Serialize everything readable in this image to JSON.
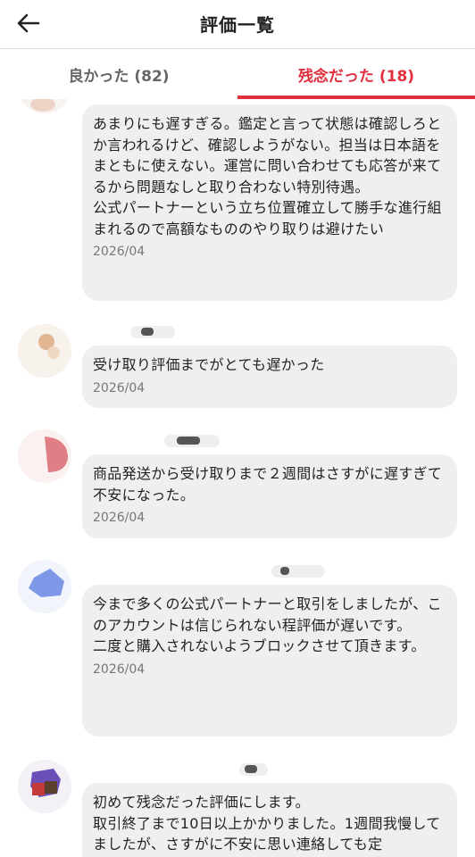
{
  "header": {
    "title": "評価一覧",
    "back_icon": "arrow-left-icon"
  },
  "tabs": [
    {
      "label": "良かった (82)",
      "active": false
    },
    {
      "label": "残念だった (18)",
      "active": true
    }
  ],
  "colors": {
    "accent": "#e0303d",
    "bubble": "#efefef",
    "text": "#222222",
    "muted": "#777777"
  },
  "reviews": [
    {
      "text": "あまりにも遅すぎる。鑑定と言って状態は確認しろとか言われるけど、確認しようがない。担当は日本語をまともに使えない。運営に問い合わせても応答が来てるから問題なしと取り合わない特別待遇。\n公式パートナーという立ち位置確立して勝手な進行組まれるので高額なもののやり取りは避けたい",
      "date": "2026/04"
    },
    {
      "text": "受け取り評価までがとても遅かった",
      "date": "2026/04"
    },
    {
      "text": "商品発送から受け取りまで２週間はさすがに遅すぎて不安になった。",
      "date": "2026/04"
    },
    {
      "text": "今まで多くの公式パートナーと取引をしましたが、このアカウントは信じられない程評価が遅いです。\n二度と購入されないようブロックさせて頂きます。",
      "date": "2026/04"
    },
    {
      "text": "初めて残念だった評価にします。\n取引終了まで10日以上かかりました。1週間我慢してましたが、さすがに不安に思い連絡しても定",
      "date": ""
    }
  ]
}
